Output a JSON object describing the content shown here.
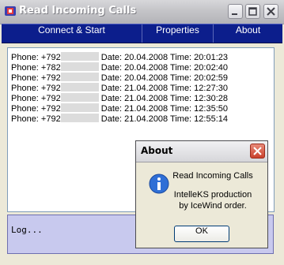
{
  "window": {
    "title": "Read Incoming Calls"
  },
  "menu": {
    "items": [
      "Connect & Start",
      "Properties",
      "About"
    ]
  },
  "calls": [
    {
      "phone_prefix": "Phone: +792",
      "date_label": "Date: 20.04.2008 Time: 20:01:23"
    },
    {
      "phone_prefix": "Phone: +782",
      "date_label": "Date: 20.04.2008 Time: 20:02:40"
    },
    {
      "phone_prefix": "Phone: +792",
      "date_label": "Date: 20.04.2008 Time: 20:02:59"
    },
    {
      "phone_prefix": "Phone: +792",
      "date_label": "Date: 21.04.2008 Time: 12:27:30"
    },
    {
      "phone_prefix": "Phone: +792",
      "date_label": "Date: 21.04.2008 Time: 12:30:28"
    },
    {
      "phone_prefix": "Phone: +792",
      "date_label": "Date: 21.04.2008 Time: 12:35:50"
    },
    {
      "phone_prefix": "Phone: +792",
      "date_label": "Date: 21.04.2008 Time: 12:55:14"
    }
  ],
  "log": {
    "text": "Log..."
  },
  "about_dialog": {
    "title": "About",
    "line1": "Read Incoming Calls",
    "line2": "IntelleKS production",
    "line3": "by IceWind order.",
    "ok_label": "OK"
  },
  "colors": {
    "menubar": "#0c1e8c",
    "log_bg": "#c8c9ee",
    "dialog_close": "#c9412c"
  }
}
